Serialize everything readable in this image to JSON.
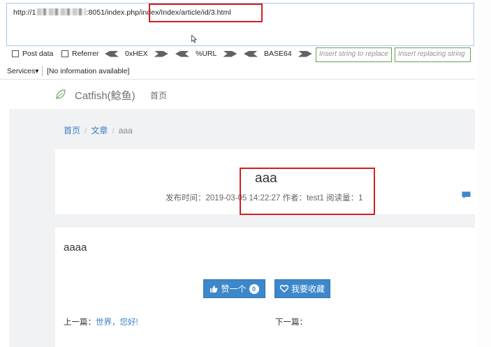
{
  "hackbar": {
    "url_prefix": "http://1",
    "url_suffix": ":8051/index.php/index/Index/article/id/3.html",
    "options": {
      "post_data": "Post data",
      "referrer": "Referrer",
      "hex": "0xHEX",
      "url": "%URL",
      "base64": "BASE64"
    },
    "replace_search_placeholder": "Insert string to replace",
    "replace_with_placeholder": "Insert replacing string"
  },
  "services_bar": {
    "services_label": "Services",
    "info_text": "[No information available]"
  },
  "site": {
    "brand": "Catfish(鲶鱼)",
    "nav_home": "首页"
  },
  "breadcrumb": {
    "home": "首页",
    "category": "文章",
    "current": "aaa"
  },
  "article": {
    "title": "aaa",
    "meta": "发布时间：2019-03-05 14:22:27 作者：test1 阅读量：1",
    "body": "aaaa",
    "like_label": "赞一个",
    "like_count": "0",
    "favorite_label": "我要收藏",
    "prev_label": "上一篇：",
    "prev_link": "世界，您好!",
    "next_label": "下一篇："
  },
  "colors": {
    "highlight_box": "#d11f22",
    "button": "#3d87cb",
    "link": "#3a7ec4"
  }
}
